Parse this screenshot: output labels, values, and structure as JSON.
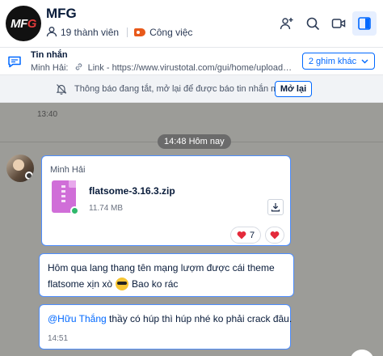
{
  "header": {
    "group_name": "MFG",
    "logo_text_main": "MF",
    "logo_text_accent": "G",
    "members": "19 thành viên",
    "category": "Công việc",
    "accent_color": "#0068ff",
    "tag_color": "#e8591a"
  },
  "pinned": {
    "title": "Tin nhắn",
    "sender": "Minh Hải:",
    "link_label": "Link",
    "preview": "- https://www.virustotal.com/gui/home/upload quan...",
    "more_button": "2 ghim khác"
  },
  "notice": {
    "text": "Thông báo đang tắt, mở lại để được báo tin nhắn mới",
    "button": "Mở lại"
  },
  "chat": {
    "earlier_time": "13:40",
    "date_divider": "14:48 Hôm nay",
    "file_message": {
      "sender": "Minh Hải",
      "file_name": "flatsome-3.16.3.zip",
      "file_size": "11.74 MB",
      "reaction_count": "7"
    },
    "message_1": {
      "line1": "Hôm qua lang thang tên mạng lượm được cái theme",
      "line2_before": "flatsome xịn xò",
      "line2_after": "Bao ko rác"
    },
    "message_2": {
      "mention": "@Hữu Thắng",
      "text": " thầy có húp thì húp nhé ko phải crack đâu.",
      "time": "14:51"
    }
  }
}
